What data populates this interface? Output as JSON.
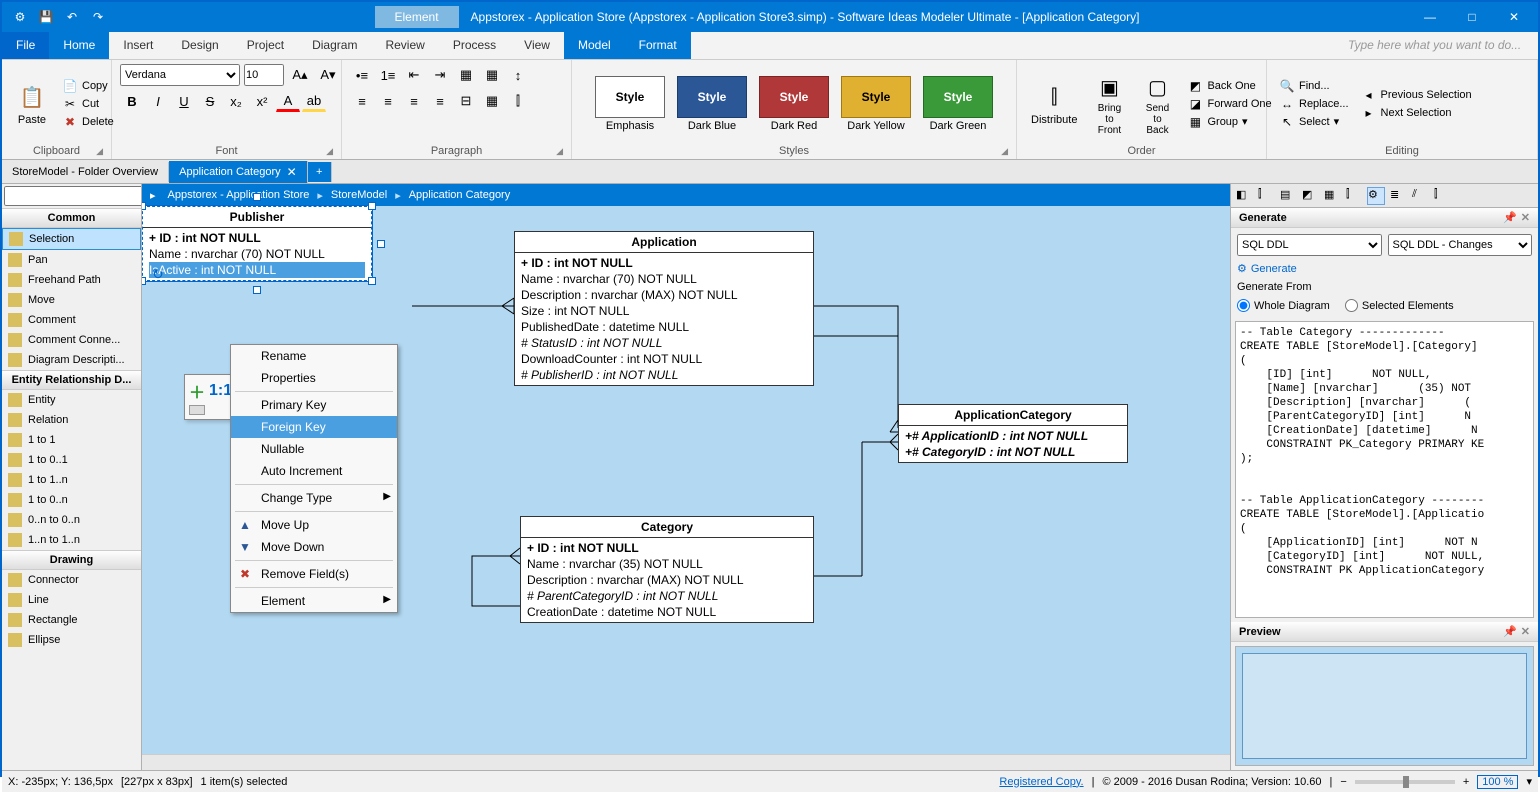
{
  "titlebar": {
    "element_tab": "Element",
    "title": "Appstorex - Application Store (Appstorex - Application Store3.simp)  - Software Ideas Modeler Ultimate - [Application Category]"
  },
  "menubar": {
    "items": [
      "File",
      "Home",
      "Insert",
      "Design",
      "Project",
      "Diagram",
      "Review",
      "Process",
      "View",
      "Model",
      "Format"
    ],
    "search_placeholder": "Type here what you want to do..."
  },
  "ribbon": {
    "clipboard": {
      "paste": "Paste",
      "copy": "Copy",
      "cut": "Cut",
      "delete": "Delete",
      "label": "Clipboard"
    },
    "font": {
      "family": "Verdana",
      "size": "10",
      "label": "Font"
    },
    "paragraph": {
      "label": "Paragraph"
    },
    "styles": {
      "items": [
        {
          "label": "Style",
          "caption": "Emphasis",
          "bg": "#ffffff",
          "fg": "#000",
          "border": "#666"
        },
        {
          "label": "Style",
          "caption": "Dark Blue",
          "bg": "#2b5797",
          "fg": "#fff",
          "border": "#1a3d6e"
        },
        {
          "label": "Style",
          "caption": "Dark Red",
          "bg": "#b13838",
          "fg": "#fff",
          "border": "#7a2424"
        },
        {
          "label": "Style",
          "caption": "Dark Yellow",
          "bg": "#e0b030",
          "fg": "#000",
          "border": "#a07a10"
        },
        {
          "label": "Style",
          "caption": "Dark Green",
          "bg": "#3a9a3a",
          "fg": "#fff",
          "border": "#246b24"
        }
      ],
      "label": "Styles"
    },
    "order": {
      "distribute": "Distribute",
      "bring_front": "Bring to Front",
      "send_back": "Send to Back",
      "back_one": "Back One",
      "forward_one": "Forward One",
      "group": "Group",
      "label": "Order"
    },
    "editing": {
      "find": "Find...",
      "replace": "Replace...",
      "select": "Select",
      "prev_sel": "Previous Selection",
      "next_sel": "Next Selection",
      "label": "Editing"
    }
  },
  "tabs": {
    "items": [
      {
        "label": "StoreModel - Folder Overview",
        "active": false
      },
      {
        "label": "Application Category",
        "active": true
      }
    ]
  },
  "left_panel": {
    "common_label": "Common",
    "common_items": [
      "Selection",
      "Pan",
      "Freehand Path",
      "Move",
      "Comment",
      "Comment Conne...",
      "Diagram Descripti..."
    ],
    "erd_label": "Entity Relationship D...",
    "erd_items": [
      "Entity",
      "Relation",
      "1 to 1",
      "1 to 0..1",
      "1 to 1..n",
      "1 to 0..n",
      "0..n to 0..n",
      "1..n to 1..n"
    ],
    "drawing_label": "Drawing",
    "drawing_items": [
      "Connector",
      "Line",
      "Rectangle",
      "Ellipse"
    ]
  },
  "breadcrumb": [
    "Appstorex - Application Store",
    "StoreModel",
    "Application Category"
  ],
  "entities": {
    "publisher": {
      "title": "Publisher",
      "rows": [
        {
          "text": "+ ID : int NOT NULL",
          "bold": true
        },
        {
          "text": "Name : nvarchar (70)  NOT NULL"
        },
        {
          "text": "IsActive : int NOT NULL",
          "selected": true
        }
      ]
    },
    "application": {
      "title": "Application",
      "rows": [
        {
          "text": "+ ID : int NOT NULL",
          "bold": true
        },
        {
          "text": "Name : nvarchar (70)  NOT NULL"
        },
        {
          "text": "Description : nvarchar (MAX)  NOT NULL"
        },
        {
          "text": "Size : int NOT NULL"
        },
        {
          "text": "PublishedDate : datetime NULL"
        },
        {
          "text": "# StatusID : int NOT NULL",
          "italic": true
        },
        {
          "text": "DownloadCounter : int NOT NULL"
        },
        {
          "text": "# PublisherID : int NOT NULL",
          "italic": true
        }
      ]
    },
    "app_category": {
      "title": "ApplicationCategory",
      "rows": [
        {
          "text": "+# ApplicationID : int NOT NULL",
          "bold": true,
          "italic": true
        },
        {
          "text": "+# CategoryID : int NOT NULL",
          "bold": true,
          "italic": true
        }
      ]
    },
    "category": {
      "title": "Category",
      "rows": [
        {
          "text": "+ ID : int NOT NULL",
          "bold": true
        },
        {
          "text": "Name : nvarchar (35)  NOT NULL"
        },
        {
          "text": "Description : nvarchar (MAX)  NOT NULL"
        },
        {
          "text": "# ParentCategoryID : int NOT NULL",
          "italic": true
        },
        {
          "text": "CreationDate : datetime NOT NULL"
        }
      ]
    }
  },
  "context_menu": {
    "items": [
      {
        "label": "Rename"
      },
      {
        "label": "Properties"
      },
      {
        "sep": true
      },
      {
        "label": "Primary Key"
      },
      {
        "label": "Foreign Key",
        "hover": true
      },
      {
        "label": "Nullable"
      },
      {
        "label": "Auto Increment"
      },
      {
        "sep": true
      },
      {
        "label": "Change Type",
        "submenu": true
      },
      {
        "sep": true
      },
      {
        "label": "Move Up",
        "icon": "▲",
        "icon_color": "#2b5797"
      },
      {
        "label": "Move Down",
        "icon": "▼",
        "icon_color": "#2b5797"
      },
      {
        "sep": true
      },
      {
        "label": "Remove Field(s)",
        "icon": "✖",
        "icon_color": "#c0392b"
      },
      {
        "sep": true
      },
      {
        "label": "Element",
        "submenu": true
      }
    ]
  },
  "mini_toolbar": {
    "ratio": "1:1"
  },
  "generate": {
    "header": "Generate",
    "source_sel": "SQL DDL",
    "target_sel": "SQL DDL - Changes",
    "generate_link": "Generate",
    "from_label": "Generate From",
    "radio1": "Whole Diagram",
    "radio2": "Selected Elements",
    "code": "-- Table Category -------------\nCREATE TABLE [StoreModel].[Category]\n(\n    [ID] [int]      NOT NULL,\n    [Name] [nvarchar]      (35) NOT\n    [Description] [nvarchar]      (\n    [ParentCategoryID] [int]      N\n    [CreationDate] [datetime]      N\n    CONSTRAINT PK_Category PRIMARY KE\n);\n\n\n-- Table ApplicationCategory --------\nCREATE TABLE [StoreModel].[Applicatio\n(\n    [ApplicationID] [int]      NOT N\n    [CategoryID] [int]      NOT NULL,\n    CONSTRAINT PK ApplicationCategory"
  },
  "preview": {
    "header": "Preview"
  },
  "statusbar": {
    "coords": "X: -235px; Y: 136,5px",
    "item_size": "[227px x 83px]",
    "selection": "1 item(s) selected",
    "reg": "Registered Copy.",
    "copyright": "© 2009 - 2016 Dusan Rodina; Version: 10.60",
    "zoom": "100 %"
  }
}
